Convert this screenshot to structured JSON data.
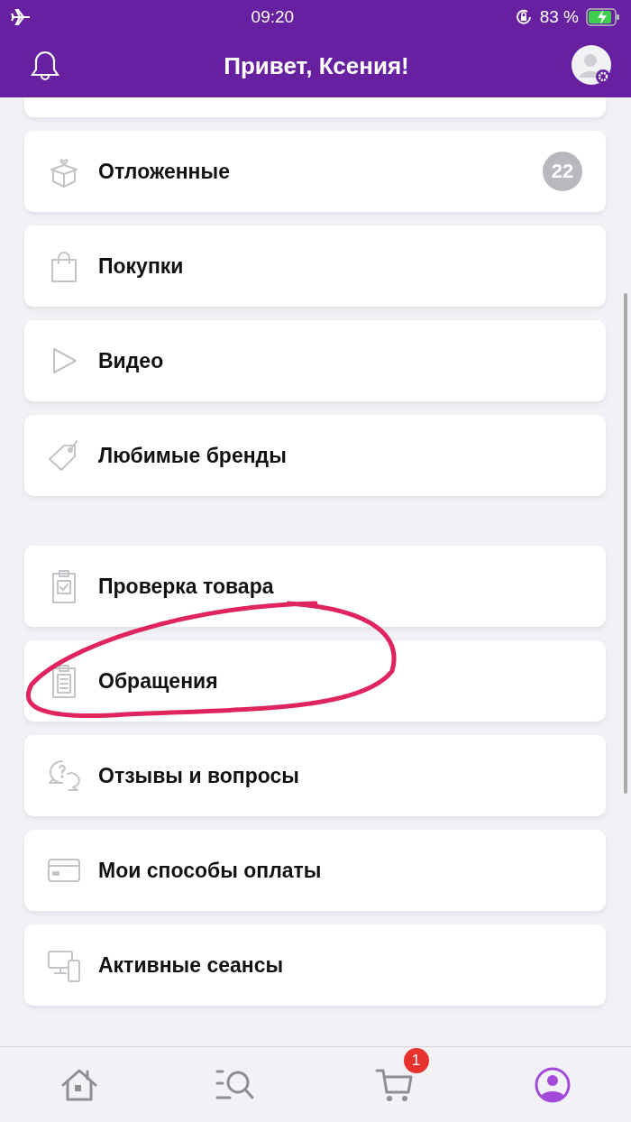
{
  "status_bar": {
    "time": "09:20",
    "battery": "83 %"
  },
  "header": {
    "title": "Привет, Ксения!"
  },
  "groups": [
    {
      "items": [
        {
          "label": "Отложенные",
          "badge": "22",
          "circled": false
        },
        {
          "label": "Покупки",
          "circled": false
        },
        {
          "label": "Видео",
          "circled": false
        },
        {
          "label": "Любимые бренды",
          "circled": false
        }
      ]
    },
    {
      "items": [
        {
          "label": "Проверка товара",
          "circled": false
        },
        {
          "label": "Обращения",
          "circled": true
        },
        {
          "label": "Отзывы и вопросы",
          "circled": false
        },
        {
          "label": "Мои способы оплаты",
          "circled": false
        },
        {
          "label": "Активные сеансы",
          "circled": false
        }
      ]
    }
  ],
  "tab_bar": [
    {
      "selected": false
    },
    {
      "selected": false
    },
    {
      "selected": false,
      "badge": "1"
    },
    {
      "selected": true
    }
  ]
}
